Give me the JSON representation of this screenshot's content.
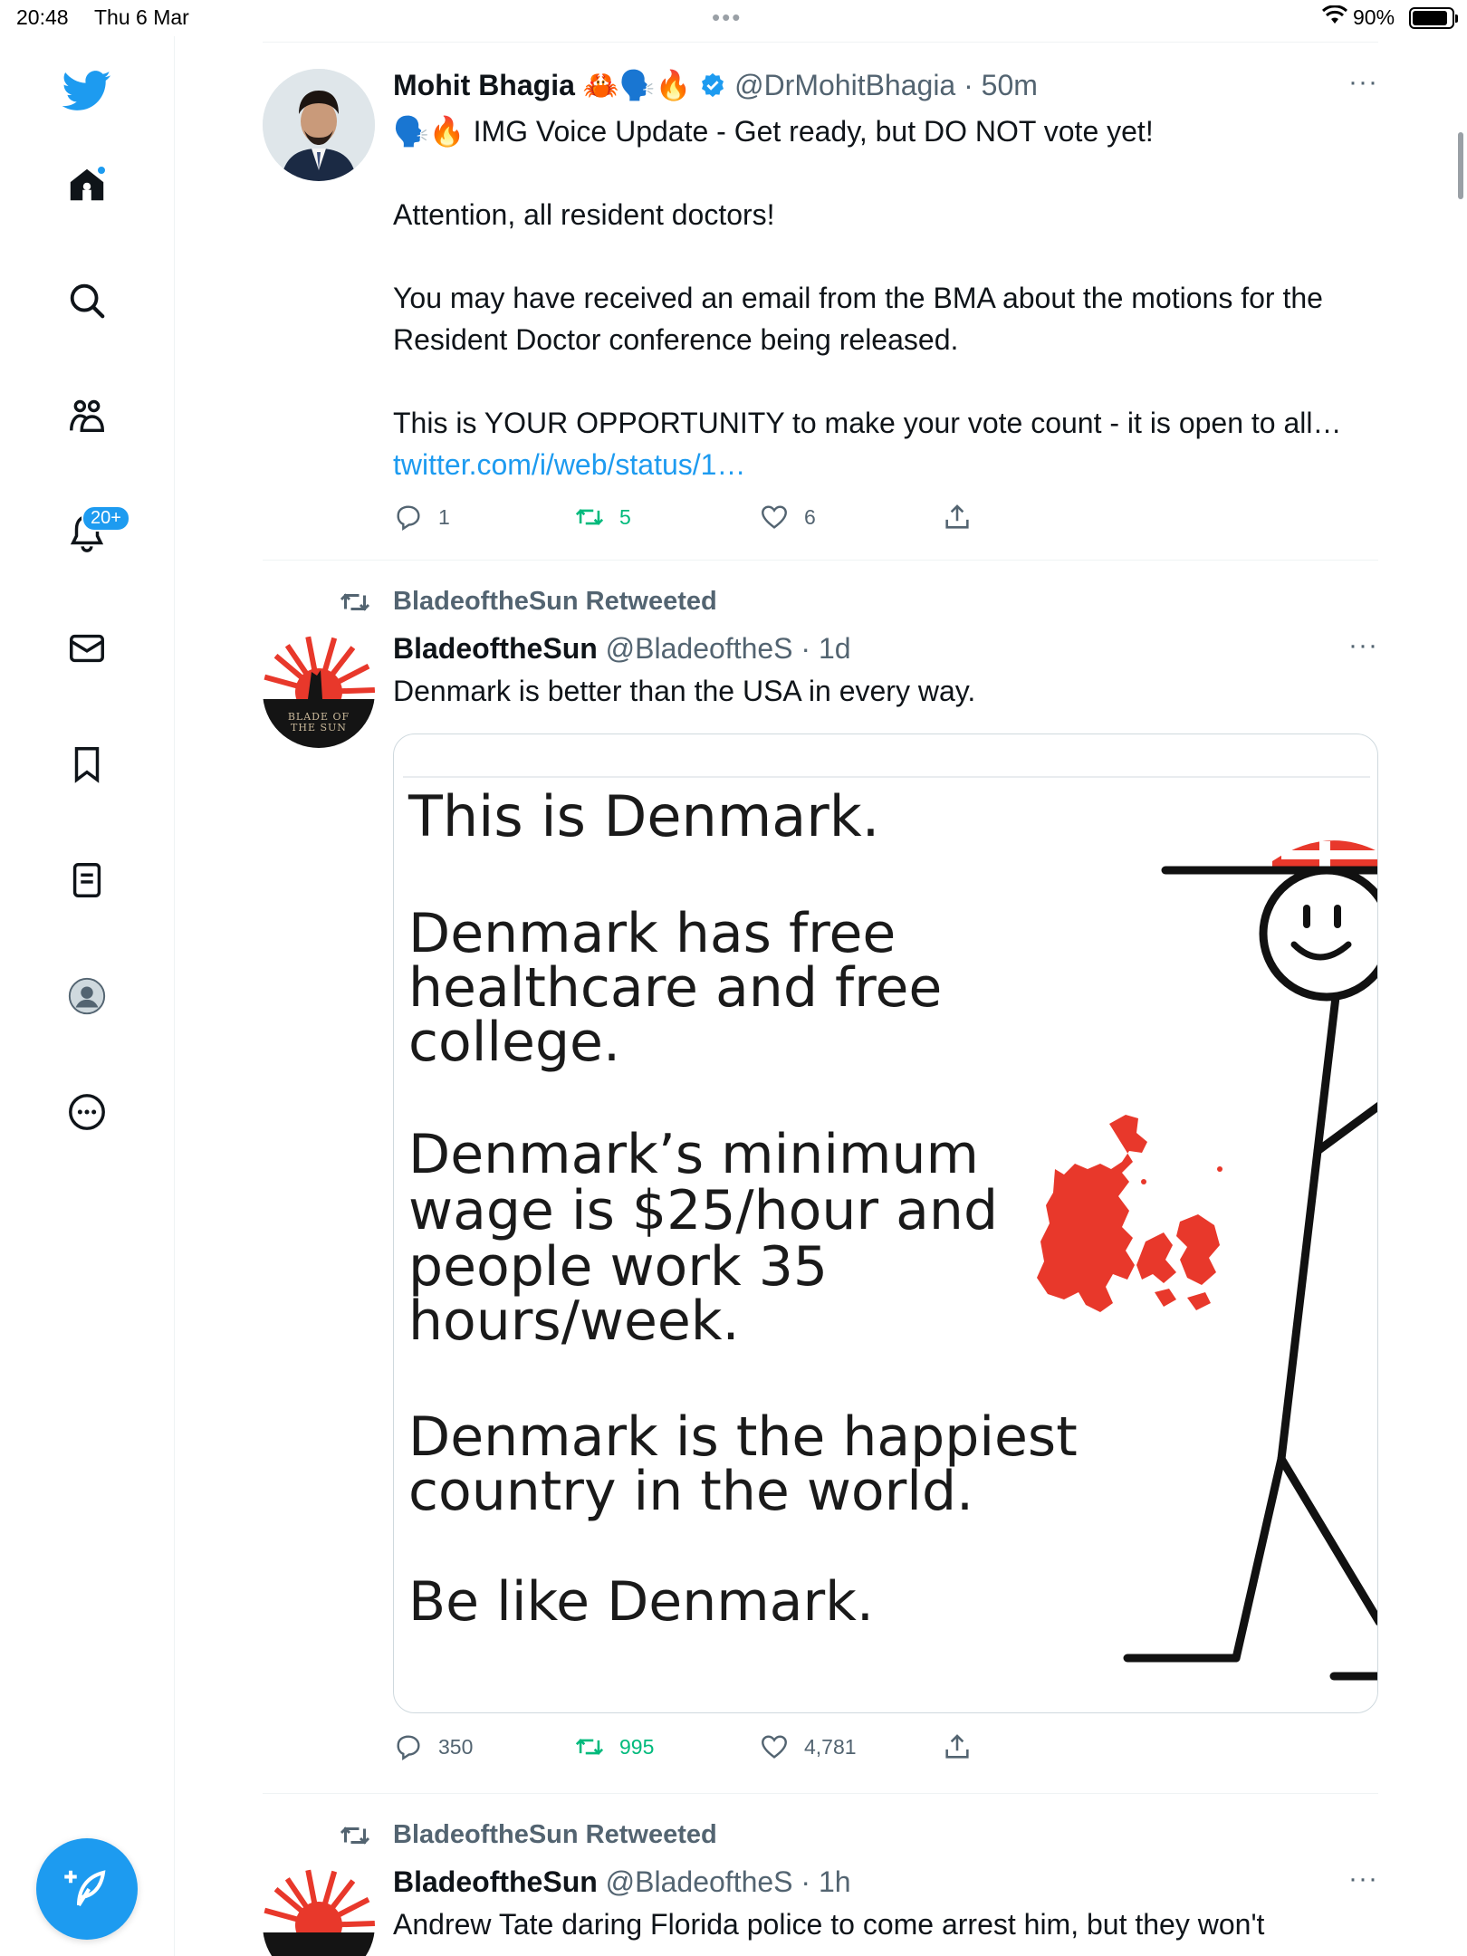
{
  "status_bar": {
    "time": "20:48",
    "date": "Thu 6 Mar",
    "battery_percent": "90%",
    "battery_level": 0.9
  },
  "sidebar": {
    "items": [
      {
        "name": "twitter-logo-icon"
      },
      {
        "name": "home-icon"
      },
      {
        "name": "search-icon"
      },
      {
        "name": "communities-icon"
      },
      {
        "name": "notifications-icon",
        "badge": "20+"
      },
      {
        "name": "messages-icon"
      },
      {
        "name": "bookmarks-icon"
      },
      {
        "name": "lists-icon"
      },
      {
        "name": "profile-icon"
      },
      {
        "name": "more-icon"
      }
    ],
    "compose": {
      "name": "compose-tweet-icon"
    }
  },
  "colors": {
    "accent": "#1d9bf0",
    "retweet": "#00ba7c",
    "muted": "#536471",
    "meme_red": "#e8382b"
  },
  "tweets": [
    {
      "name": "Mohit Bhagia",
      "name_emojis": "🦀🗣️🔥",
      "handle": "@DrMohitBhagia",
      "time": "· 50m",
      "line1": "🗣️🔥 IMG Voice Update - Get ready,  but DO NOT vote yet!",
      "line2": "Attention, all resident doctors!",
      "line3": "You may have received an email from the BMA about the motions for the Resident Doctor conference being released.",
      "line4": "This is YOUR OPPORTUNITY to make your vote count - it is open to all…",
      "link": "twitter.com/i/web/status/1…",
      "replies": "1",
      "retweets": "5",
      "likes": "6"
    },
    {
      "retweeted_by": "BladeoftheSun Retweeted",
      "name": "BladeoftheSun",
      "handle": "@BladeoftheS",
      "time": "· 1d",
      "text": "Denmark is better than the USA in every way.",
      "replies": "350",
      "retweets": "995",
      "likes": "4,781",
      "image": {
        "line1": "This is Denmark.",
        "line2a": "Denmark has free",
        "line2b": "healthcare and free",
        "line2c": "college.",
        "line3a": "Denmark’s minimum",
        "line3b": "wage is $25/hour and",
        "line3c": "people work 35",
        "line3d": "hours/week.",
        "line4a": "Denmark is the happiest",
        "line4b": "country in the world.",
        "line5": "Be like Denmark."
      }
    },
    {
      "retweeted_by": "BladeoftheSun Retweeted",
      "name": "BladeoftheSun",
      "handle": "@BladeoftheS",
      "time": "· 1h",
      "text": "Andrew Tate daring Florida police to come arrest him, but they won't"
    }
  ],
  "avatar_text": {
    "blade_logo": "BLADE OF THE SUN"
  }
}
